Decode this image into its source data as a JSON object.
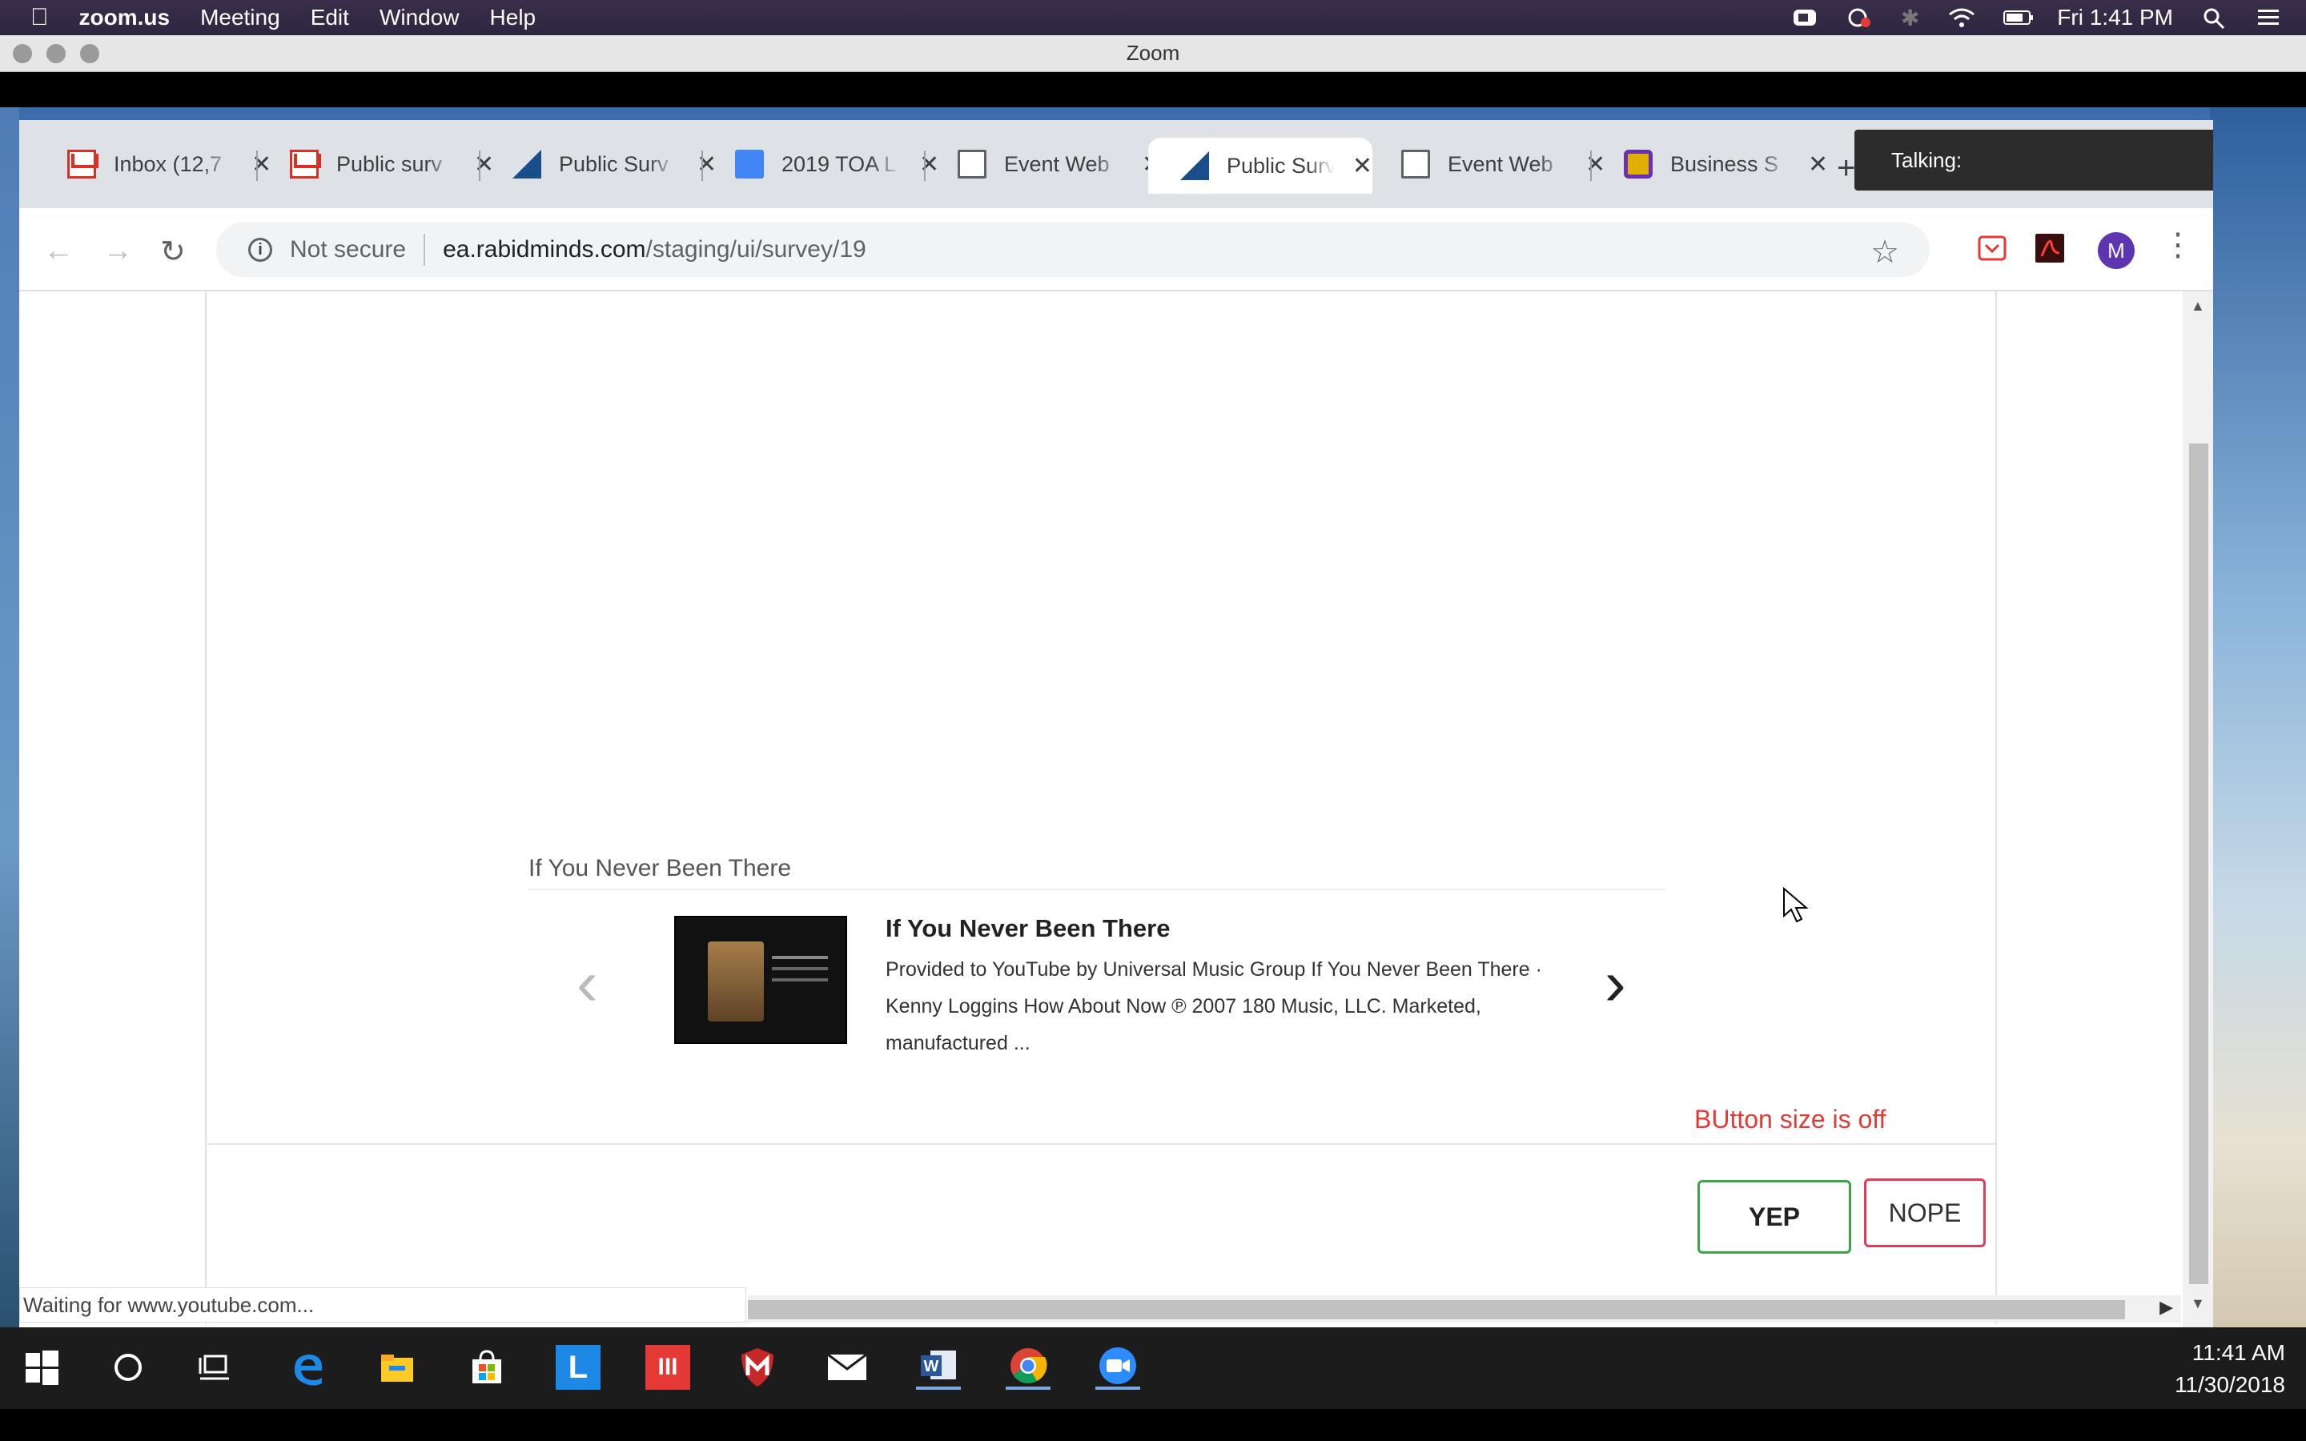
{
  "mac_menubar": {
    "app": "zoom.us",
    "menus": [
      "Meeting",
      "Edit",
      "Window",
      "Help"
    ],
    "clock": "Fri 1:41 PM"
  },
  "zoom_window": {
    "title": "Zoom",
    "talking_label": "Talking:"
  },
  "browser": {
    "tabs": [
      {
        "title": "Inbox (12,7",
        "icon": "gmail-icon"
      },
      {
        "title": "Public surv",
        "icon": "gmail-icon"
      },
      {
        "title": "Public Surv",
        "icon": "triangle-logo-icon"
      },
      {
        "title": "2019 TOA L",
        "icon": "google-doc-icon"
      },
      {
        "title": "Event Web",
        "icon": "page-icon"
      },
      {
        "title": "Public Surv",
        "icon": "triangle-logo-icon",
        "active": true
      },
      {
        "title": "Event Web",
        "icon": "page-icon"
      },
      {
        "title": "Business S",
        "icon": "business-app-icon"
      }
    ],
    "address": {
      "security": "Not secure",
      "host": "ea.rabidminds.com",
      "path": "/staging/ui/survey/19"
    },
    "avatar_letter": "M",
    "status_text": "Waiting for www.youtube.com..."
  },
  "survey": {
    "video_heading": "If You Never Been There",
    "video_title": "If You Never Been There",
    "video_description": "Provided to YouTube by Universal Music Group If You Never Been There · Kenny Loggins How About Now ℗ 2007 180 Music, LLC. Marketed, manufactured ...",
    "annotation": "BUtton size is off",
    "yep_label": "YEP",
    "nope_label": "NOPE"
  },
  "taskbar": {
    "time": "11:41 AM",
    "date": "11/30/2018",
    "apps": [
      "start-icon",
      "cortana-icon",
      "task-view-icon",
      "edge-icon",
      "file-explorer-icon",
      "store-icon",
      "l-app-icon",
      "red-app-icon",
      "mcafee-icon",
      "mail-icon",
      "word-icon",
      "chrome-icon",
      "zoom-icon"
    ]
  },
  "colors": {
    "yep_border": "#3fa34d",
    "nope_border": "#e03d5a",
    "annotation": "#e53935"
  }
}
